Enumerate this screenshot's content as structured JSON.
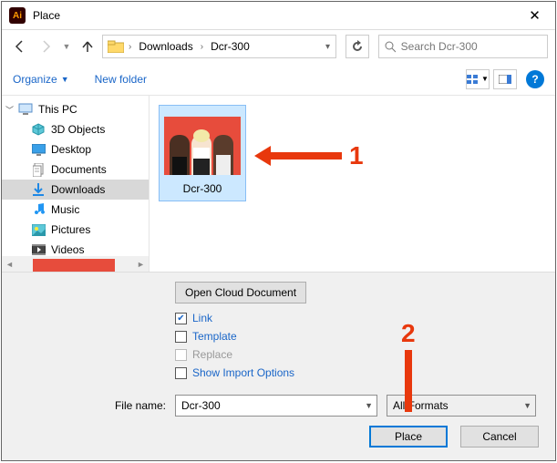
{
  "window": {
    "title": "Place"
  },
  "nav": {
    "path": [
      "Downloads",
      "Dcr-300"
    ],
    "search_placeholder": "Search Dcr-300"
  },
  "toolbar": {
    "organize": "Organize",
    "new_folder": "New folder"
  },
  "sidebar": {
    "root": "This PC",
    "items": [
      {
        "label": "3D Objects",
        "icon": "cube"
      },
      {
        "label": "Desktop",
        "icon": "desktop"
      },
      {
        "label": "Documents",
        "icon": "doc"
      },
      {
        "label": "Downloads",
        "icon": "download",
        "selected": true
      },
      {
        "label": "Music",
        "icon": "music"
      },
      {
        "label": "Pictures",
        "icon": "pictures"
      },
      {
        "label": "Videos",
        "icon": "videos"
      }
    ]
  },
  "content": {
    "file": {
      "name": "Dcr-300"
    }
  },
  "footer": {
    "cloud": "Open Cloud Document",
    "options": {
      "link": "Link",
      "template": "Template",
      "replace": "Replace",
      "show_import": "Show Import Options"
    },
    "filename_label": "File name:",
    "filename_value": "Dcr-300",
    "format_value": "All Formats",
    "place": "Place",
    "cancel": "Cancel"
  },
  "annotations": {
    "one": "1",
    "two": "2"
  }
}
